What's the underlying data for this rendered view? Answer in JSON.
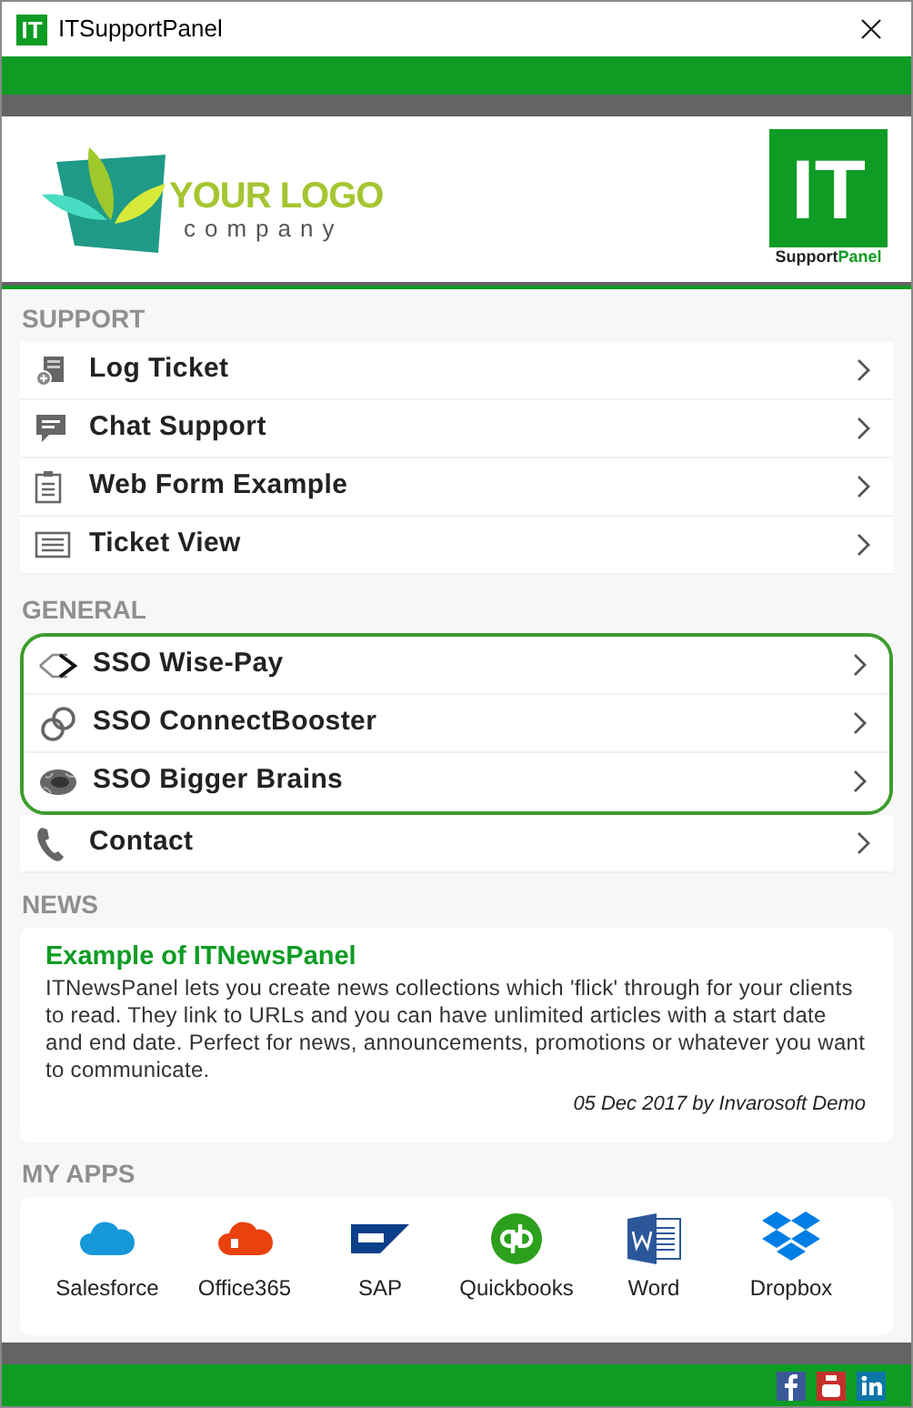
{
  "window": {
    "title": "ITSupportPanel",
    "app_badge": "IT"
  },
  "header": {
    "logo_line_1": "YOUR LOGO",
    "logo_line_2": "company",
    "badge_big": "IT",
    "badge_caption_1": "Support",
    "badge_caption_2": "Panel"
  },
  "sections": [
    {
      "title": "SUPPORT",
      "items": [
        {
          "label": "Log Ticket",
          "highlighted": false
        },
        {
          "label": "Chat Support",
          "highlighted": false
        },
        {
          "label": "Web Form Example",
          "highlighted": false
        },
        {
          "label": "Ticket View",
          "highlighted": false
        }
      ]
    },
    {
      "title": "GENERAL",
      "items": [
        {
          "label": "SSO Wise-Pay",
          "highlighted": true
        },
        {
          "label": "SSO ConnectBooster",
          "highlighted": true
        },
        {
          "label": "SSO Bigger Brains",
          "highlighted": true
        },
        {
          "label": "Contact",
          "highlighted": false
        }
      ]
    }
  ],
  "news": {
    "title": "NEWS",
    "headline": "Example of ITNewsPanel",
    "body": "ITNewsPanel lets you create news collections which 'flick' through for your clients to read. They link to URLs and you can have unlimited articles with a start date and end date. Perfect for news, announcements, promotions or whatever you want to communicate.",
    "byline": "05 Dec 2017 by Invarosoft Demo"
  },
  "apps": {
    "title": "MY APPS",
    "items": [
      {
        "label": "Salesforce"
      },
      {
        "label": "Office365"
      },
      {
        "label": "SAP"
      },
      {
        "label": "Quickbooks"
      },
      {
        "label": "Word"
      },
      {
        "label": "Dropbox"
      }
    ]
  }
}
